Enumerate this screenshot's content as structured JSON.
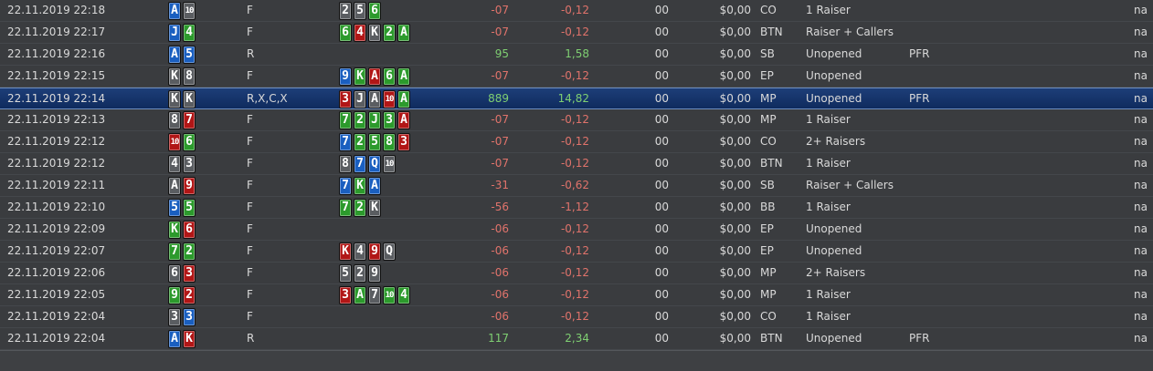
{
  "colors": {
    "spade": "#5a5d61",
    "heart": "#b11616",
    "diamond": "#1a5fc0",
    "club": "#2c9a2c",
    "negative": "#e0736b",
    "positive": "#7fcf72",
    "selected_row": "#0f2b5e"
  },
  "rows": [
    {
      "date": "22.11.2019 22:18",
      "hole": [
        {
          "r": "A",
          "s": "d"
        },
        {
          "r": "10",
          "s": "s"
        }
      ],
      "action": "F",
      "board": [
        {
          "r": "2",
          "s": "s"
        },
        {
          "r": "5",
          "s": "s"
        },
        {
          "r": "6",
          "s": "c"
        }
      ],
      "bb": "-07",
      "won": "-0,12",
      "zero": "00",
      "rake": "$0,00",
      "pos": "CO",
      "preflop": "1 Raiser",
      "pfr": "",
      "na": "na",
      "sel": false
    },
    {
      "date": "22.11.2019 22:17",
      "hole": [
        {
          "r": "J",
          "s": "d"
        },
        {
          "r": "4",
          "s": "c"
        }
      ],
      "action": "F",
      "board": [
        {
          "r": "6",
          "s": "c"
        },
        {
          "r": "4",
          "s": "h"
        },
        {
          "r": "K",
          "s": "s"
        },
        {
          "r": "2",
          "s": "c"
        },
        {
          "r": "A",
          "s": "c"
        }
      ],
      "bb": "-07",
      "won": "-0,12",
      "zero": "00",
      "rake": "$0,00",
      "pos": "BTN",
      "preflop": "Raiser + Callers",
      "pfr": "",
      "na": "na",
      "sel": false
    },
    {
      "date": "22.11.2019 22:16",
      "hole": [
        {
          "r": "A",
          "s": "d"
        },
        {
          "r": "5",
          "s": "d"
        }
      ],
      "action": "R",
      "board": [],
      "bb": "95",
      "won": "1,58",
      "zero": "00",
      "rake": "$0,00",
      "pos": "SB",
      "preflop": "Unopened",
      "pfr": "PFR",
      "na": "na",
      "sel": false
    },
    {
      "date": "22.11.2019 22:15",
      "hole": [
        {
          "r": "K",
          "s": "s"
        },
        {
          "r": "8",
          "s": "s"
        }
      ],
      "action": "F",
      "board": [
        {
          "r": "9",
          "s": "d"
        },
        {
          "r": "K",
          "s": "c"
        },
        {
          "r": "A",
          "s": "h"
        },
        {
          "r": "6",
          "s": "c"
        },
        {
          "r": "A",
          "s": "c"
        }
      ],
      "bb": "-07",
      "won": "-0,12",
      "zero": "00",
      "rake": "$0,00",
      "pos": "EP",
      "preflop": "Unopened",
      "pfr": "",
      "na": "na",
      "sel": false
    },
    {
      "date": "22.11.2019 22:14",
      "hole": [
        {
          "r": "K",
          "s": "s"
        },
        {
          "r": "K",
          "s": "s"
        }
      ],
      "action": "R,X,C,X",
      "board": [
        {
          "r": "3",
          "s": "h"
        },
        {
          "r": "J",
          "s": "s"
        },
        {
          "r": "A",
          "s": "s"
        },
        {
          "r": "10",
          "s": "h"
        },
        {
          "r": "A",
          "s": "c"
        }
      ],
      "bb": "889",
      "won": "14,82",
      "zero": "00",
      "rake": "$0,00",
      "pos": "MP",
      "preflop": "Unopened",
      "pfr": "PFR",
      "na": "na",
      "sel": true
    },
    {
      "date": "22.11.2019 22:13",
      "hole": [
        {
          "r": "8",
          "s": "s"
        },
        {
          "r": "7",
          "s": "h"
        }
      ],
      "action": "F",
      "board": [
        {
          "r": "7",
          "s": "c"
        },
        {
          "r": "2",
          "s": "c"
        },
        {
          "r": "J",
          "s": "c"
        },
        {
          "r": "3",
          "s": "c"
        },
        {
          "r": "A",
          "s": "h"
        }
      ],
      "bb": "-07",
      "won": "-0,12",
      "zero": "00",
      "rake": "$0,00",
      "pos": "MP",
      "preflop": "1 Raiser",
      "pfr": "",
      "na": "na",
      "sel": false
    },
    {
      "date": "22.11.2019 22:12",
      "hole": [
        {
          "r": "10",
          "s": "h"
        },
        {
          "r": "6",
          "s": "c"
        }
      ],
      "action": "F",
      "board": [
        {
          "r": "7",
          "s": "d"
        },
        {
          "r": "2",
          "s": "c"
        },
        {
          "r": "5",
          "s": "c"
        },
        {
          "r": "8",
          "s": "c"
        },
        {
          "r": "3",
          "s": "h"
        }
      ],
      "bb": "-07",
      "won": "-0,12",
      "zero": "00",
      "rake": "$0,00",
      "pos": "CO",
      "preflop": "2+ Raisers",
      "pfr": "",
      "na": "na",
      "sel": false
    },
    {
      "date": "22.11.2019 22:12",
      "hole": [
        {
          "r": "4",
          "s": "s"
        },
        {
          "r": "3",
          "s": "s"
        }
      ],
      "action": "F",
      "board": [
        {
          "r": "8",
          "s": "s"
        },
        {
          "r": "7",
          "s": "d"
        },
        {
          "r": "Q",
          "s": "d"
        },
        {
          "r": "10",
          "s": "s"
        }
      ],
      "bb": "-07",
      "won": "-0,12",
      "zero": "00",
      "rake": "$0,00",
      "pos": "BTN",
      "preflop": "1 Raiser",
      "pfr": "",
      "na": "na",
      "sel": false
    },
    {
      "date": "22.11.2019 22:11",
      "hole": [
        {
          "r": "A",
          "s": "s"
        },
        {
          "r": "9",
          "s": "h"
        }
      ],
      "action": "F",
      "board": [
        {
          "r": "7",
          "s": "d"
        },
        {
          "r": "K",
          "s": "c"
        },
        {
          "r": "A",
          "s": "d"
        }
      ],
      "bb": "-31",
      "won": "-0,62",
      "zero": "00",
      "rake": "$0,00",
      "pos": "SB",
      "preflop": "Raiser + Callers",
      "pfr": "",
      "na": "na",
      "sel": false
    },
    {
      "date": "22.11.2019 22:10",
      "hole": [
        {
          "r": "5",
          "s": "d"
        },
        {
          "r": "5",
          "s": "c"
        }
      ],
      "action": "F",
      "board": [
        {
          "r": "7",
          "s": "c"
        },
        {
          "r": "2",
          "s": "c"
        },
        {
          "r": "K",
          "s": "s"
        }
      ],
      "bb": "-56",
      "won": "-1,12",
      "zero": "00",
      "rake": "$0,00",
      "pos": "BB",
      "preflop": "1 Raiser",
      "pfr": "",
      "na": "na",
      "sel": false
    },
    {
      "date": "22.11.2019 22:09",
      "hole": [
        {
          "r": "K",
          "s": "c"
        },
        {
          "r": "6",
          "s": "h"
        }
      ],
      "action": "F",
      "board": [],
      "bb": "-06",
      "won": "-0,12",
      "zero": "00",
      "rake": "$0,00",
      "pos": "EP",
      "preflop": "Unopened",
      "pfr": "",
      "na": "na",
      "sel": false
    },
    {
      "date": "22.11.2019 22:07",
      "hole": [
        {
          "r": "7",
          "s": "c"
        },
        {
          "r": "2",
          "s": "c"
        }
      ],
      "action": "F",
      "board": [
        {
          "r": "K",
          "s": "h"
        },
        {
          "r": "4",
          "s": "s"
        },
        {
          "r": "9",
          "s": "h"
        },
        {
          "r": "Q",
          "s": "s"
        }
      ],
      "bb": "-06",
      "won": "-0,12",
      "zero": "00",
      "rake": "$0,00",
      "pos": "EP",
      "preflop": "Unopened",
      "pfr": "",
      "na": "na",
      "sel": false
    },
    {
      "date": "22.11.2019 22:06",
      "hole": [
        {
          "r": "6",
          "s": "s"
        },
        {
          "r": "3",
          "s": "h"
        }
      ],
      "action": "F",
      "board": [
        {
          "r": "5",
          "s": "s"
        },
        {
          "r": "2",
          "s": "s"
        },
        {
          "r": "9",
          "s": "s"
        }
      ],
      "bb": "-06",
      "won": "-0,12",
      "zero": "00",
      "rake": "$0,00",
      "pos": "MP",
      "preflop": "2+ Raisers",
      "pfr": "",
      "na": "na",
      "sel": false
    },
    {
      "date": "22.11.2019 22:05",
      "hole": [
        {
          "r": "9",
          "s": "c"
        },
        {
          "r": "2",
          "s": "h"
        }
      ],
      "action": "F",
      "board": [
        {
          "r": "3",
          "s": "h"
        },
        {
          "r": "A",
          "s": "c"
        },
        {
          "r": "7",
          "s": "s"
        },
        {
          "r": "10",
          "s": "c"
        },
        {
          "r": "4",
          "s": "c"
        }
      ],
      "bb": "-06",
      "won": "-0,12",
      "zero": "00",
      "rake": "$0,00",
      "pos": "MP",
      "preflop": "1 Raiser",
      "pfr": "",
      "na": "na",
      "sel": false
    },
    {
      "date": "22.11.2019 22:04",
      "hole": [
        {
          "r": "3",
          "s": "s"
        },
        {
          "r": "3",
          "s": "d"
        }
      ],
      "action": "F",
      "board": [],
      "bb": "-06",
      "won": "-0,12",
      "zero": "00",
      "rake": "$0,00",
      "pos": "CO",
      "preflop": "1 Raiser",
      "pfr": "",
      "na": "na",
      "sel": false
    },
    {
      "date": "22.11.2019 22:04",
      "hole": [
        {
          "r": "A",
          "s": "d"
        },
        {
          "r": "K",
          "s": "h"
        }
      ],
      "action": "R",
      "board": [],
      "bb": "117",
      "won": "2,34",
      "zero": "00",
      "rake": "$0,00",
      "pos": "BTN",
      "preflop": "Unopened",
      "pfr": "PFR",
      "na": "na",
      "sel": false
    }
  ]
}
